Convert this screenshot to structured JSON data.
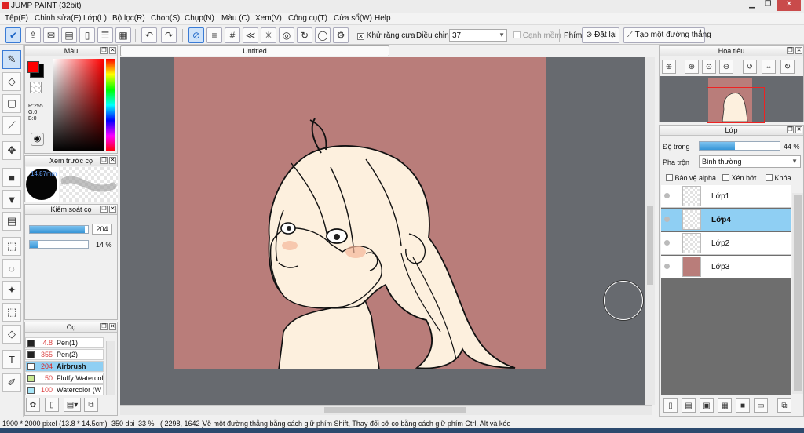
{
  "window": {
    "title": "JUMP PAINT (32bit)"
  },
  "menu": [
    "Tệp(F)",
    "Chỉnh sửa(E)",
    "Lớp(L)",
    "Bộ lọc(R)",
    "Chọn(S)",
    "Chụp(N)",
    "Màu (C)",
    "Xem(V)",
    "Công cụ(T)",
    "Cửa sổ(W)",
    "Help"
  ],
  "toolbar": {
    "antialias_label": "Khử răng cưa",
    "adjust_label": "Điều chỉnh",
    "adjust_value": "37",
    "margin_label": "Cạnh mềm",
    "key_label": "Phím",
    "reset_label": "Đặt lại",
    "line_label": "Tạo một đường thẳng"
  },
  "color_panel": {
    "title": "Màu",
    "r": "R:255",
    "g": "G:0",
    "b": "B:0",
    "fg_color": "#ff0000",
    "bg_color": "#000000"
  },
  "preview_panel": {
    "title": "Xem trước cọ",
    "size_label": "14.87mm"
  },
  "control_panel": {
    "title": "Kiểm soát cọ",
    "size_value": "204",
    "opacity_value": "14",
    "opacity_unit": "%",
    "size_fill": 0.95,
    "opacity_fill": 0.14
  },
  "brush_panel": {
    "title": "Cọ",
    "items": [
      {
        "size": "4.8",
        "name": "Pen(1)",
        "color": "#222222",
        "selected": false
      },
      {
        "size": "355",
        "name": "Pen(2)",
        "color": "#222222",
        "selected": false
      },
      {
        "size": "204",
        "name": "Airbrush",
        "color": "#ffffff",
        "selected": true
      },
      {
        "size": "50",
        "name": "Fluffy Watercol",
        "color": "#c8e890",
        "selected": false
      },
      {
        "size": "100",
        "name": "Watercolor (W",
        "color": "#a8e6f8",
        "selected": false
      }
    ]
  },
  "canvas": {
    "tab": "Untitled",
    "bg_color": "#b97d7a"
  },
  "navigator": {
    "title": "Hoa tiêu"
  },
  "layers_panel": {
    "title": "Lớp",
    "opacity_label": "Độ trong",
    "opacity_value": "44",
    "opacity_unit": "%",
    "opacity_fill": 0.44,
    "blend_label": "Pha trộn",
    "blend_value": "Bình thường",
    "protect_alpha": "Bảo vệ alpha",
    "clipping": "Xén bớt",
    "lock": "Khóa",
    "layers": [
      {
        "name": "Lớp1",
        "selected": false
      },
      {
        "name": "Lớp4",
        "selected": true
      },
      {
        "name": "Lớp2",
        "selected": false
      },
      {
        "name": "Lớp3",
        "selected": false
      }
    ]
  },
  "status": {
    "size_px": "1900 * 2000 pixel",
    "size_cm": "(13.8 * 14.5cm)",
    "dpi": "350 dpi",
    "zoom": "33 %",
    "coords": "( 2298, 1642 )",
    "hint": "Vẽ một đường thẳng bằng cách giữ phím Shift, Thay đổi cỡ cọ bằng cách giữ phím Ctrl, Alt và kéo"
  }
}
